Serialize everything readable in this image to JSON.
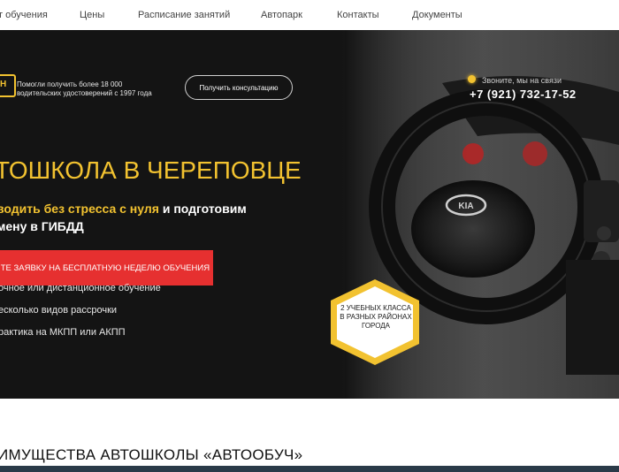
{
  "nav": {
    "items": [
      "т обучения",
      "Цены",
      "Расписание занятий",
      "Автопарк",
      "Контакты",
      "Документы"
    ]
  },
  "hero": {
    "tagline": "Помогли получить более 18 000 водительских удостоверений с 1997 года",
    "consult_label": "Получить консультацию",
    "call_label": "Звоните, мы на связи",
    "phone": "+7 (921) 732-17-52",
    "title": "ТОШКОЛА В ЧЕРЕПОВЦЕ",
    "subtitle_highlight": "водить без стресса с нуля",
    "subtitle_rest_1": " и подготовим",
    "subtitle_line2": "мену в ГИБДД",
    "cta_label": "ИТЕ ЗАЯВКУ НА БЕСПЛАТНУЮ НЕДЕЛЮ ОБУЧЕНИЯ",
    "features": [
      "очное или дистанционное обучение",
      "есколько видов рассрочки",
      "рактика на МКПП или АКПП"
    ],
    "badge": "2 УЧЕБНЫХ КЛАССА В РАЗНЫХ РАЙОНАХ ГОРОДА",
    "steering_logo": "KIA"
  },
  "section": {
    "title": "ИМУЩЕСТВА АВТОШКОЛЫ «АВТООБУЧ»"
  },
  "colors": {
    "accent": "#f2c230",
    "cta": "#e63030",
    "dark": "#141414"
  },
  "icons": {
    "logo": "logo-icon",
    "call": "call-indicator-icon"
  }
}
